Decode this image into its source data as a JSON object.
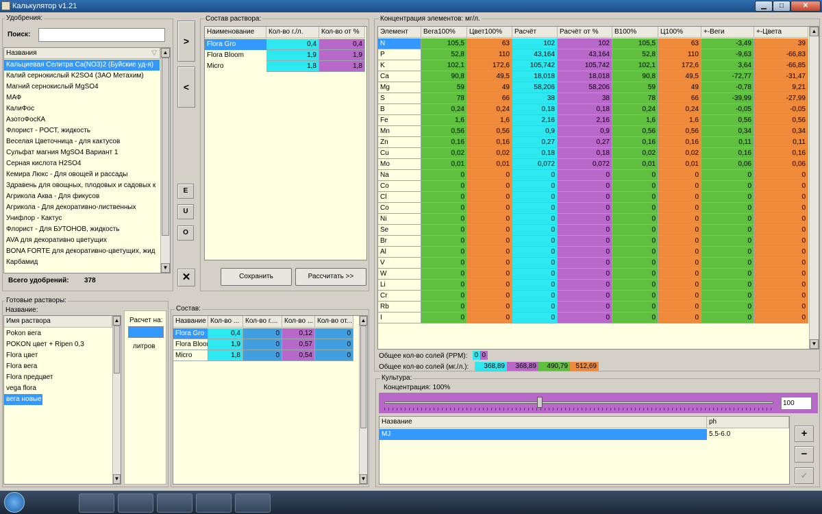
{
  "window": {
    "title": "Калькулятор v1.21",
    "min": "▁",
    "max": "□",
    "close": "✕"
  },
  "fertilizers": {
    "legend": "Удобрения:",
    "search_label": "Поиск:",
    "search_value": "",
    "column": "Названия",
    "items": [
      "Кальциевая Селитра Ca(NO3)2 (Буйские уд-я)",
      "Калий  сернокислый  K2SO4 (ЗАО Метахим)",
      "Магний сернокислый MgSO4",
      "МАФ",
      "КалиФос",
      "АзотоФосКА",
      "Флорист - РОСТ, жидкость",
      "Веселая Цветочница - для кактусов",
      "Сульфат магния MgSO4 Вариант 1",
      "Серная кислота H2SO4",
      "Кемира Люкс - Для овощей и рассады",
      "Здравень для овощных, плодовых и садовых к",
      "Агрикола Аква - Для фикусов",
      "Агрикола - Для декоративно-лиственных",
      "Унифлор - Кактус",
      "Флорист - Для БУТОНОВ, жидкость",
      "AVA для декоративно цветущих",
      "BONA FORTE для декоративно-цветущих, жид",
      "Карбамид"
    ],
    "selected_index": 0,
    "total_label": "Всего удобрений:",
    "total_value": "378"
  },
  "side_buttons": {
    "add": ">",
    "remove": "<",
    "e": "E",
    "u": "U",
    "o": "O",
    "clear": "✕"
  },
  "composition": {
    "legend": "Состав раствора:",
    "headers": [
      "Наименование",
      "Кол-во г./л.",
      "Кол-во от %"
    ],
    "rows": [
      {
        "name": "Flora Gro",
        "qty": "0,4",
        "pct": "0,4"
      },
      {
        "name": "Flora Bloom",
        "qty": "1,9",
        "pct": "1,9"
      },
      {
        "name": "Micro",
        "qty": "1,8",
        "pct": "1,8"
      }
    ],
    "save": "Сохранить",
    "calc": "Рассчитать >>"
  },
  "concentration": {
    "legend": "Концентрация элементов: мг/л.",
    "headers": [
      "Элемент",
      "Вега100%",
      "Цвет100%",
      "Расчёт",
      "Расчёт от %",
      "B100%",
      "Ц100%",
      "+-Веги",
      "+-Цвета"
    ],
    "col_colors": [
      "#ffffe1",
      "#5fbf3f",
      "#ee8a3a",
      "#2ee8f0",
      "#b868c8",
      "#5fbf3f",
      "#ee8a3a",
      "#5fbf3f",
      "#ee8a3a"
    ],
    "rows": [
      [
        "N",
        "105,5",
        "63",
        "102",
        "102",
        "105,5",
        "63",
        "-3,49",
        "39"
      ],
      [
        "P",
        "52,8",
        "110",
        "43,164",
        "43,164",
        "52,8",
        "110",
        "-9,63",
        "-66,83"
      ],
      [
        "K",
        "102,1",
        "172,6",
        "105,742",
        "105,742",
        "102,1",
        "172,6",
        "3,64",
        "-66,85"
      ],
      [
        "Ca",
        "90,8",
        "49,5",
        "18,018",
        "18,018",
        "90,8",
        "49,5",
        "-72,77",
        "-31,47"
      ],
      [
        "Mg",
        "59",
        "49",
        "58,206",
        "58,206",
        "59",
        "49",
        "-0,78",
        "9,21"
      ],
      [
        "S",
        "78",
        "66",
        "38",
        "38",
        "78",
        "66",
        "-39,99",
        "-27,99"
      ],
      [
        "B",
        "0,24",
        "0,24",
        "0,18",
        "0,18",
        "0,24",
        "0,24",
        "-0,05",
        "-0,05"
      ],
      [
        "Fe",
        "1,6",
        "1,6",
        "2,16",
        "2,16",
        "1,6",
        "1,6",
        "0,56",
        "0,56"
      ],
      [
        "Mn",
        "0,56",
        "0,56",
        "0,9",
        "0,9",
        "0,56",
        "0,56",
        "0,34",
        "0,34"
      ],
      [
        "Zn",
        "0,16",
        "0,16",
        "0,27",
        "0,27",
        "0,16",
        "0,16",
        "0,11",
        "0,11"
      ],
      [
        "Cu",
        "0,02",
        "0,02",
        "0,18",
        "0,18",
        "0,02",
        "0,02",
        "0,16",
        "0,16"
      ],
      [
        "Mo",
        "0,01",
        "0,01",
        "0,072",
        "0,072",
        "0,01",
        "0,01",
        "0,06",
        "0,06"
      ],
      [
        "Na",
        "0",
        "0",
        "0",
        "0",
        "0",
        "0",
        "0",
        "0"
      ],
      [
        "Co",
        "0",
        "0",
        "0",
        "0",
        "0",
        "0",
        "0",
        "0"
      ],
      [
        "Cl",
        "0",
        "0",
        "0",
        "0",
        "0",
        "0",
        "0",
        "0"
      ],
      [
        "Co",
        "0",
        "0",
        "0",
        "0",
        "0",
        "0",
        "0",
        "0"
      ],
      [
        "Ni",
        "0",
        "0",
        "0",
        "0",
        "0",
        "0",
        "0",
        "0"
      ],
      [
        "Se",
        "0",
        "0",
        "0",
        "0",
        "0",
        "0",
        "0",
        "0"
      ],
      [
        "Br",
        "0",
        "0",
        "0",
        "0",
        "0",
        "0",
        "0",
        "0"
      ],
      [
        "Al",
        "0",
        "0",
        "0",
        "0",
        "0",
        "0",
        "0",
        "0"
      ],
      [
        "V",
        "0",
        "0",
        "0",
        "0",
        "0",
        "0",
        "0",
        "0"
      ],
      [
        "W",
        "0",
        "0",
        "0",
        "0",
        "0",
        "0",
        "0",
        "0"
      ],
      [
        "Li",
        "0",
        "0",
        "0",
        "0",
        "0",
        "0",
        "0",
        "0"
      ],
      [
        "Cr",
        "0",
        "0",
        "0",
        "0",
        "0",
        "0",
        "0",
        "0"
      ],
      [
        "Rb",
        "0",
        "0",
        "0",
        "0",
        "0",
        "0",
        "0",
        "0"
      ],
      [
        "I",
        "0",
        "0",
        "0",
        "0",
        "0",
        "0",
        "0",
        "0"
      ]
    ],
    "ppm_label": "Общее кол-во солей (PPM):",
    "ppm_values": [
      "0",
      "0"
    ],
    "mg_label": "Общее кол-во солей (мг./л.):",
    "mg_values": [
      "368,89",
      "368,89",
      "490,79",
      "512,69"
    ]
  },
  "ready": {
    "legend": "Готовые растворы:",
    "name_label": "Название:",
    "column": "Имя раствора",
    "items": [
      "Pokon вега",
      "POKON цвет + Ripen 0,3",
      "Flora цвет",
      "Flora вега",
      "Flora предцвет",
      "vega flora",
      "вега новые"
    ],
    "selected_index": 6,
    "calc_label": "Расчет на:",
    "calc_value": "",
    "liters": "литров"
  },
  "sostav": {
    "legend": "Состав:",
    "headers": [
      "Название",
      "Кол-во ...",
      "Кол-во г....",
      "Кол-во ...",
      "Кол-во от..."
    ],
    "rows": [
      [
        "Flora Gro",
        "0,4",
        "0",
        "0,12",
        "0"
      ],
      [
        "Flora Bloom",
        "1,9",
        "0",
        "0,57",
        "0"
      ],
      [
        "Micro",
        "1,8",
        "0",
        "0,54",
        "0"
      ]
    ]
  },
  "culture": {
    "legend": "Культура:",
    "conc_label": "Концентрация: 100%",
    "slider_value": "100",
    "slider_fraction": 0.4,
    "headers": [
      "Название",
      "ph"
    ],
    "rows": [
      {
        "name": "MJ",
        "ph": "5.5-6.0"
      }
    ],
    "plus": "+",
    "minus": "−",
    "edit": "✓"
  }
}
